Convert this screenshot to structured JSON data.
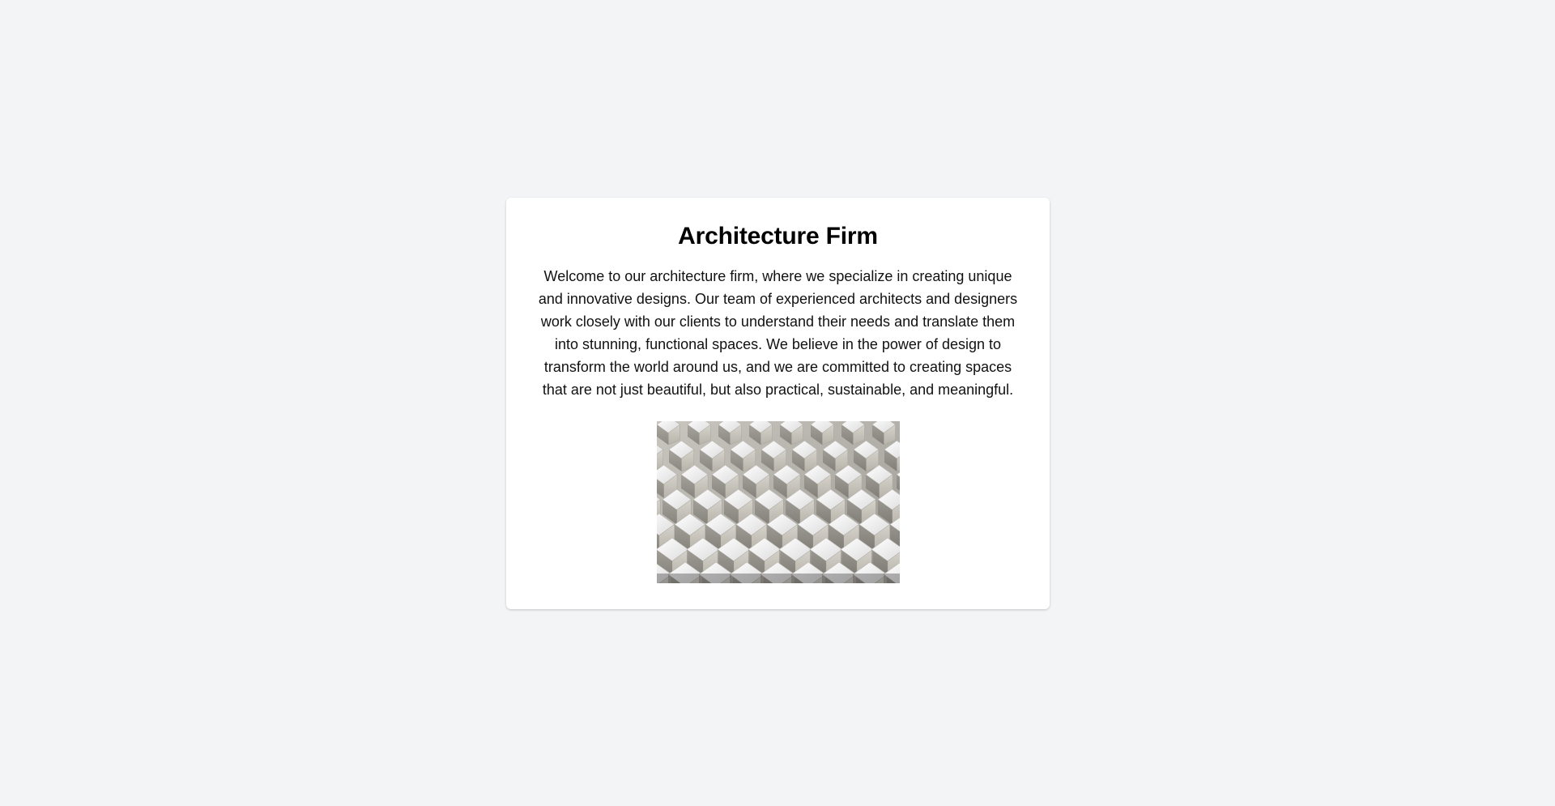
{
  "page": {
    "background": "#f3f4f6"
  },
  "card": {
    "title": "Architecture Firm",
    "description": "Welcome to our architecture firm, where we specialize in creating unique and innovative designs. Our team of experienced architects and designers work closely with our clients to understand their needs and translate them into stunning, functional spaces. We believe in the power of design to transform the world around us, and we are committed to creating spaces that are not just beautiful, but also practical, sustainable, and meaningful.",
    "image": {
      "icon": "architecture-facade-photo"
    }
  }
}
